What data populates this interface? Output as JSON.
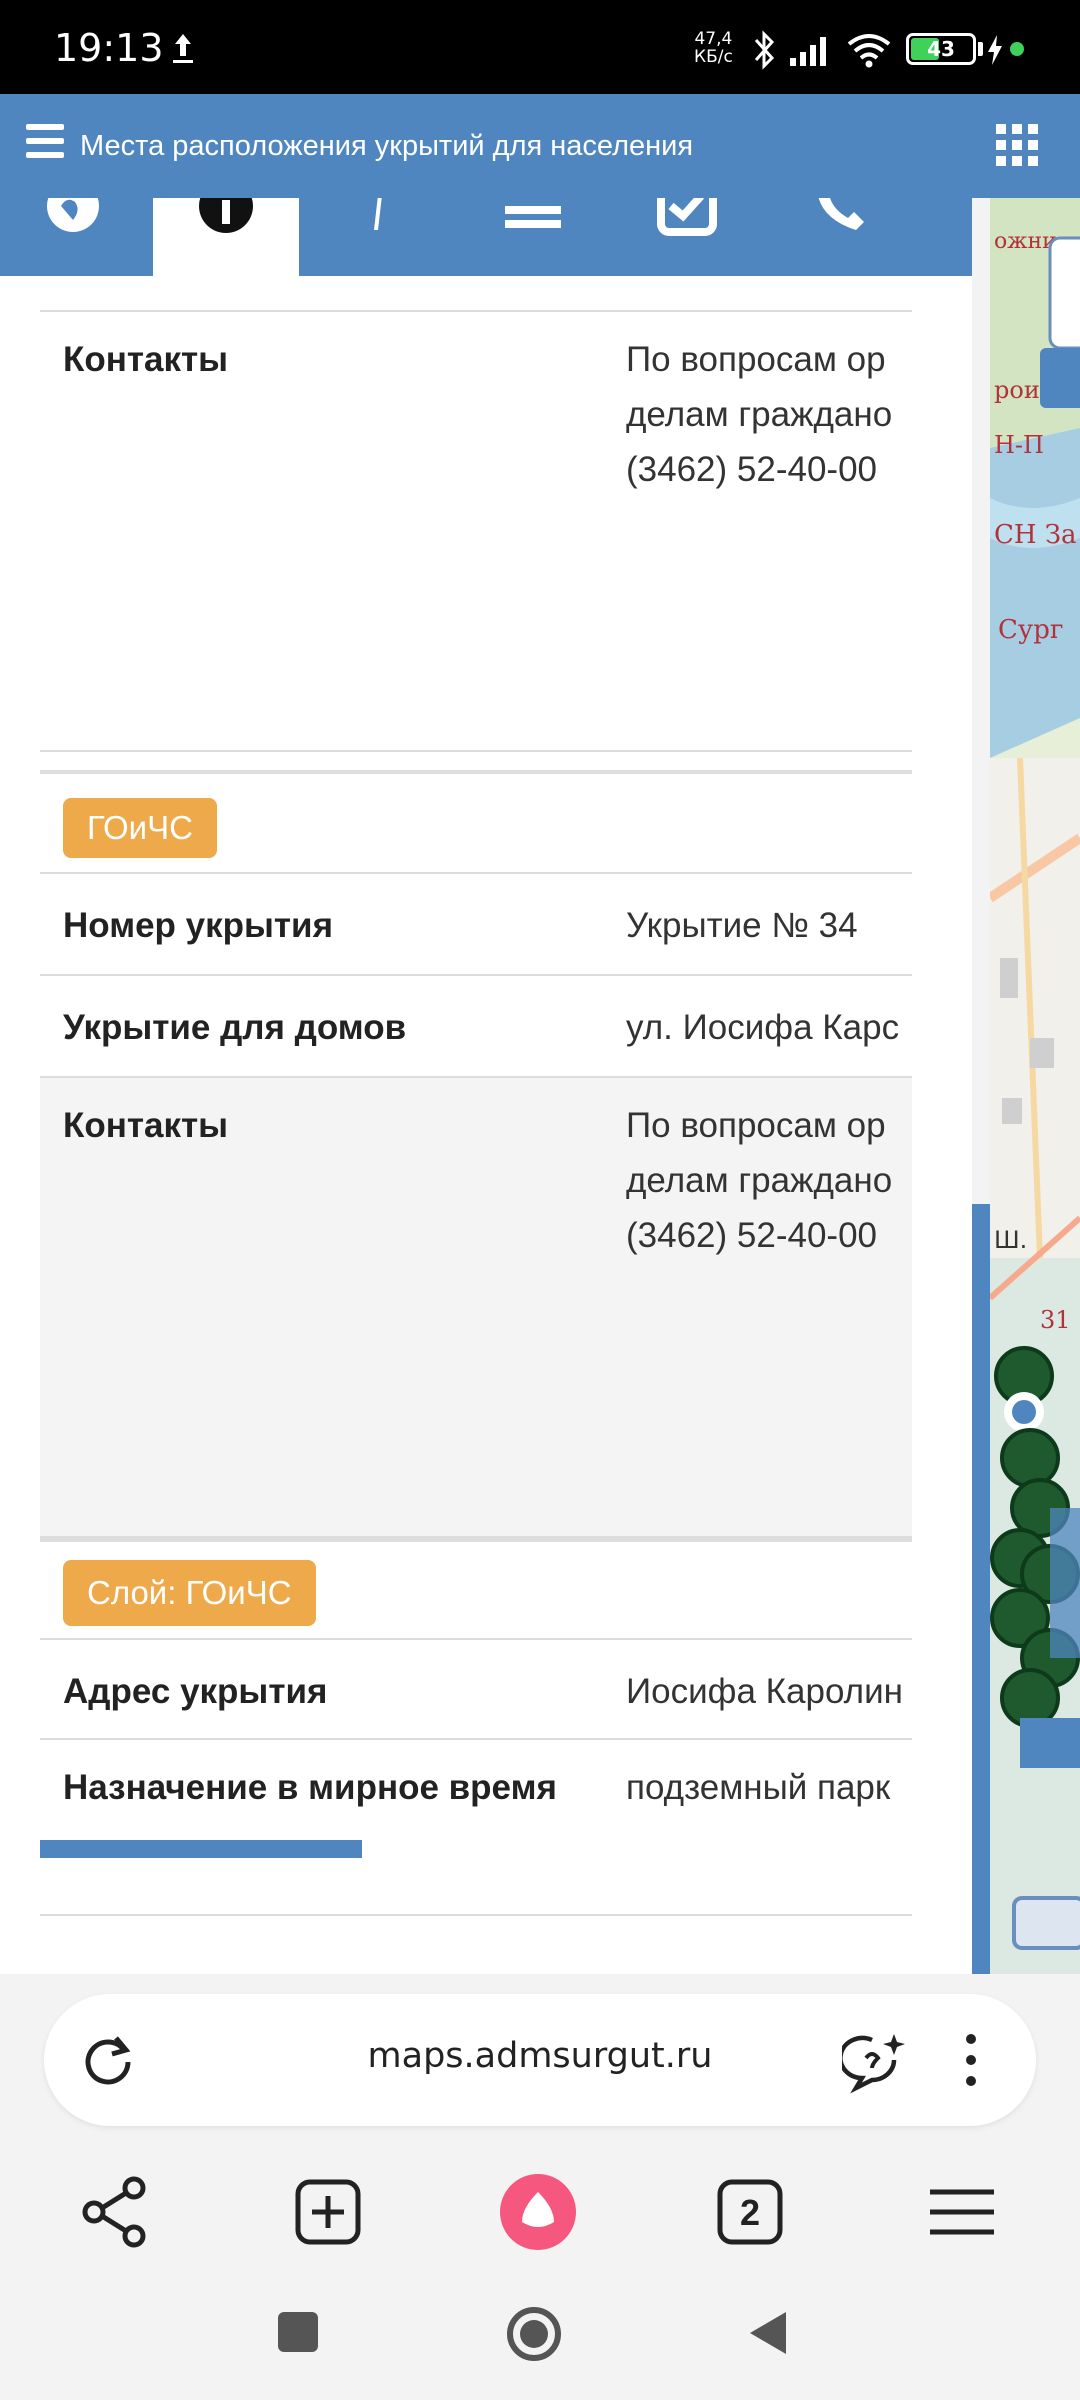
{
  "status_bar": {
    "time": "19:13",
    "net_speed_top": "47,4",
    "net_speed_bottom": "КБ/с",
    "battery": "43"
  },
  "header": {
    "title": "Места расположения укрытий для населения"
  },
  "popup": {
    "top_row": {
      "label": "Контакты",
      "value_lines": [
        "По вопросам ор",
        "делам граждано",
        "(3462) 52-40-00"
      ]
    },
    "section1": {
      "badge": "ГОиЧС",
      "rows": [
        {
          "label": "Номер укрытия",
          "value": "Укрытие № 34"
        },
        {
          "label": "Укрытие для домов",
          "value": "ул. Иосифа Карс"
        }
      ],
      "contacts": {
        "label": "Контакты",
        "value_lines": [
          "По вопросам ор",
          "делам граждано",
          "(3462) 52-40-00"
        ]
      }
    },
    "section2": {
      "badge": "Слой: ГОиЧС",
      "rows": [
        {
          "label": "Адрес укрытия",
          "value": "Иосифа Каролин"
        },
        {
          "label": "Назначение в мирное время",
          "value": "подземный парк"
        }
      ]
    }
  },
  "browser": {
    "url": "maps.admsurgut.ru",
    "tabs_count": "2"
  },
  "colors": {
    "header_blue": "#4f86bf",
    "badge_orange": "#eeaa4a"
  }
}
